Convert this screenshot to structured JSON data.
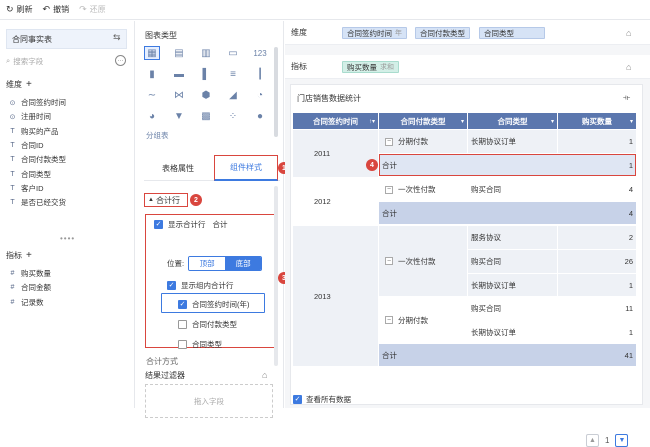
{
  "toolbar": {
    "refresh": "刷新",
    "undo": "撤销",
    "redo": "还原"
  },
  "left": {
    "dataset": "合同事实表",
    "search_placeholder": "搜索字段",
    "dimensions_title": "维度",
    "dimensions": [
      "合同签约时间",
      "注册时间",
      "购买的产品",
      "合同ID",
      "合同付款类型",
      "合同类型",
      "客户ID",
      "是否已经交货"
    ],
    "dimension_icons": [
      "⊙",
      "⊙",
      "T",
      "T",
      "T",
      "T",
      "T",
      "T"
    ],
    "measures_title": "指标",
    "measures": [
      "购买数量",
      "合同金额",
      "记录数"
    ],
    "measure_icons": [
      "#",
      "#",
      "#"
    ]
  },
  "mid": {
    "title": "图表类型",
    "sub_label": "分组表",
    "tabs": [
      "表格属性",
      "组件样式"
    ],
    "badge1": "1",
    "badge2": "2",
    "badge3": "3",
    "section": "合计行",
    "show_total": "显示合计行",
    "total_word": "合计",
    "position_label": "位置:",
    "position_top": "顶部",
    "position_bottom": "底部",
    "show_group_total": "显示组内合计行",
    "group_items": [
      "合同签约时间(年)",
      "合同付款类型",
      "合同类型"
    ],
    "summary_mode": "合计方式",
    "filter_title": "结果过滤器",
    "drop_hint": "拖入字段"
  },
  "right": {
    "dim_label": "维度",
    "dim_pills": [
      {
        "name": "合同签约时间",
        "sub": "年"
      },
      {
        "name": "合同付款类型",
        "sub": ""
      },
      {
        "name": "合同类型",
        "sub": ""
      }
    ],
    "measure_label": "指标",
    "measure_pill": {
      "name": "购买数量",
      "sub": "求和"
    },
    "table_title": "门店销售数据统计",
    "columns": [
      "合同签约时间",
      "合同付款类型",
      "合同类型",
      "购买数量"
    ],
    "badge4": "4",
    "rows": {
      "y2011": "2011",
      "y2012": "2012",
      "y2013": "2013",
      "r2011_pay": "分期付款",
      "r2011_type": "长期协议订单",
      "r2011_val": "1",
      "r2011_total": "合计",
      "r2011_total_val": "1",
      "r2012_pay": "一次性付款",
      "r2012_type": "购买合同",
      "r2012_val": "4",
      "r2012_total": "合计",
      "r2012_total_val": "4",
      "r2013_pay1": "一次性付款",
      "r2013_t1": "服务协议",
      "r2013_v1": "2",
      "r2013_t2": "购买合同",
      "r2013_v2": "26",
      "r2013_t3": "长期协议订单",
      "r2013_v3": "1",
      "r2013_pay2": "分期付款",
      "r2013_t4": "购买合同",
      "r2013_v4": "11",
      "r2013_t5": "长期协议订单",
      "r2013_v5": "1",
      "r2013_total": "合计",
      "r2013_total_val": "41"
    },
    "page": "1",
    "view_all": "查看所有数据"
  }
}
